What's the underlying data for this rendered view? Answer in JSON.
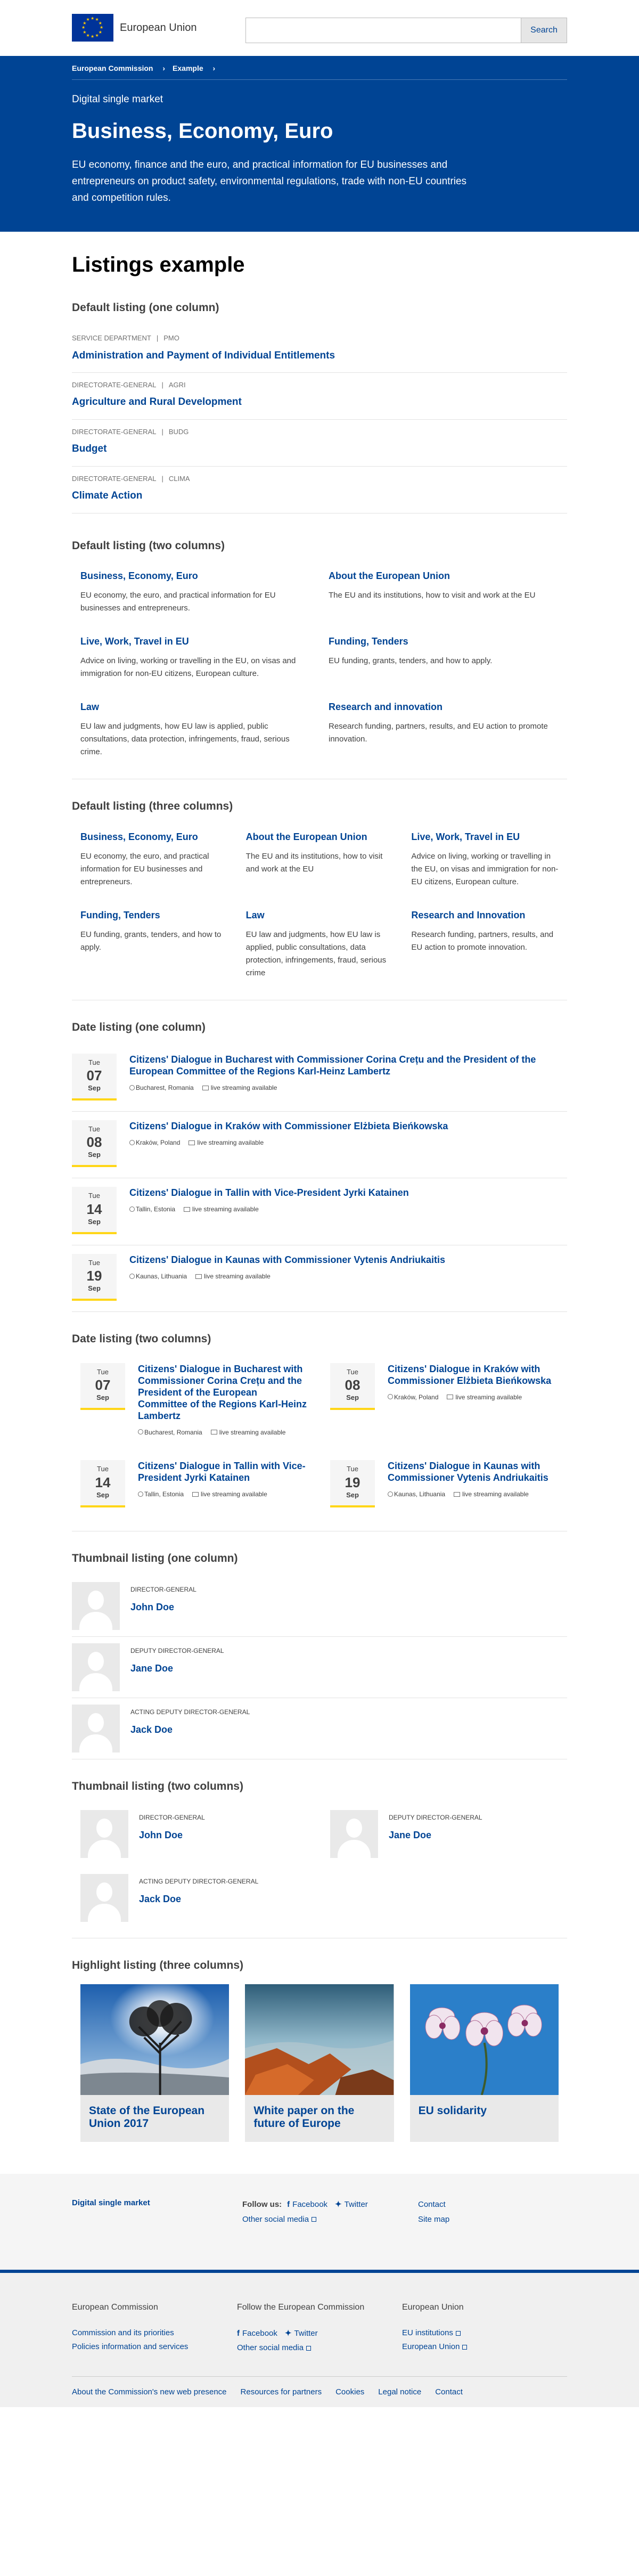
{
  "header": {
    "logo_text": "European Union",
    "search_button": "Search",
    "search_placeholder": ""
  },
  "breadcrumb": [
    "European Commission",
    "Example"
  ],
  "page_header": {
    "meta": "Digital single market",
    "title": "Business, Economy, Euro",
    "intro": "EU economy, finance and the euro, and practical information for EU businesses and entrepreneurs on product safety, environmental regulations, trade with non-EU countries and competition rules."
  },
  "listings_title": "Listings example",
  "default_one": {
    "heading": "Default listing (one column)",
    "items": [
      {
        "type": "SERVICE DEPARTMENT",
        "code": "PMO",
        "title": "Administration and Payment of Individual Entitlements"
      },
      {
        "type": "DIRECTORATE-GENERAL",
        "code": "AGRI",
        "title": "Agriculture and Rural Development"
      },
      {
        "type": "DIRECTORATE-GENERAL",
        "code": "BUDG",
        "title": "Budget"
      },
      {
        "type": "DIRECTORATE-GENERAL",
        "code": "CLIMA",
        "title": "Climate Action"
      }
    ]
  },
  "default_two": {
    "heading": "Default listing (two columns)",
    "items": [
      {
        "title": "Business, Economy, Euro",
        "desc": "EU economy, the euro, and practical information for EU businesses and entrepreneurs."
      },
      {
        "title": "About the European Union",
        "desc": "The EU and its institutions, how to visit and work at the EU"
      },
      {
        "title": "Live, Work, Travel in EU",
        "desc": "Advice on living, working or travelling in the EU, on visas and immigration for non-EU citizens, European culture."
      },
      {
        "title": "Funding, Tenders",
        "desc": "EU funding, grants, tenders, and how to apply."
      },
      {
        "title": "Law",
        "desc": "EU law and judgments, how EU law is applied, public consultations, data protection, infringements, fraud, serious crime."
      },
      {
        "title": "Research and innovation",
        "desc": "Research funding, partners, results, and EU action to promote innovation."
      }
    ]
  },
  "default_three": {
    "heading": "Default listing (three columns)",
    "items": [
      {
        "title": "Business, Economy, Euro",
        "desc": "EU economy, the euro, and practical information for EU businesses and entrepreneurs."
      },
      {
        "title": "About the European Union",
        "desc": "The EU and its institutions, how to visit and work at the EU"
      },
      {
        "title": "Live, Work, Travel in EU",
        "desc": "Advice on living, working or travelling in the EU, on visas and immigration for non-EU citizens, European culture."
      },
      {
        "title": "Funding, Tenders",
        "desc": "EU funding, grants, tenders, and how to apply."
      },
      {
        "title": "Law",
        "desc": "EU law and judgments, how EU law is applied, public consultations, data protection, infringements, fraud, serious crime"
      },
      {
        "title": "Research and Innovation",
        "desc": "Research funding, partners, results, and EU action to promote innovation."
      }
    ]
  },
  "date_one": {
    "heading": "Date listing (one column)",
    "stream_label": "live streaming available",
    "items": [
      {
        "dow": "Tue",
        "day": "07",
        "mon": "Sep",
        "title": "Citizens' Dialogue in Bucharest with Commissioner Corina Crețu and the President of the European Committee of the Regions Karl-Heinz Lambertz",
        "place": "Bucharest, Romania"
      },
      {
        "dow": "Tue",
        "day": "08",
        "mon": "Sep",
        "title": "Citizens' Dialogue in Kraków with Commissioner Elżbieta Bieńkowska",
        "place": "Kraków, Poland"
      },
      {
        "dow": "Tue",
        "day": "14",
        "mon": "Sep",
        "title": "Citizens' Dialogue in Tallin with Vice-President Jyrki Katainen",
        "place": "Tallin, Estonia"
      },
      {
        "dow": "Tue",
        "day": "19",
        "mon": "Sep",
        "title": "Citizens' Dialogue in Kaunas with Commissioner Vytenis Andriukaitis",
        "place": "Kaunas, Lithuania"
      }
    ]
  },
  "date_two": {
    "heading": "Date listing (two columns)",
    "stream_label": "live streaming available",
    "items": [
      {
        "dow": "Tue",
        "day": "07",
        "mon": "Sep",
        "title": "Citizens' Dialogue in Bucharest with Commissioner Corina Crețu and the President of the European Committee of the Regions Karl-Heinz Lambertz",
        "place": "Bucharest, Romania"
      },
      {
        "dow": "Tue",
        "day": "08",
        "mon": "Sep",
        "title": "Citizens' Dialogue in Kraków with Commissioner Elżbieta Bieńkowska",
        "place": "Kraków, Poland"
      },
      {
        "dow": "Tue",
        "day": "14",
        "mon": "Sep",
        "title": "Citizens' Dialogue in Tallin with Vice-President Jyrki Katainen",
        "place": "Tallin, Estonia"
      },
      {
        "dow": "Tue",
        "day": "19",
        "mon": "Sep",
        "title": "Citizens' Dialogue in Kaunas with Commissioner Vytenis Andriukaitis",
        "place": "Kaunas, Lithuania"
      }
    ]
  },
  "thumb_one": {
    "heading": "Thumbnail listing (one column)",
    "items": [
      {
        "role": "DIRECTOR-GENERAL",
        "name": "John Doe"
      },
      {
        "role": "DEPUTY DIRECTOR-GENERAL",
        "name": "Jane Doe"
      },
      {
        "role": "ACTING DEPUTY DIRECTOR-GENERAL",
        "name": "Jack Doe"
      }
    ]
  },
  "thumb_two": {
    "heading": "Thumbnail listing (two columns)",
    "items": [
      {
        "role": "DIRECTOR-GENERAL",
        "name": "John Doe"
      },
      {
        "role": "DEPUTY DIRECTOR-GENERAL",
        "name": "Jane Doe"
      },
      {
        "role": "ACTING DEPUTY DIRECTOR-GENERAL",
        "name": "Jack Doe"
      }
    ]
  },
  "highlight": {
    "heading": "Highlight listing (three columns)",
    "items": [
      {
        "title": "State of the European Union 2017",
        "image": "sunburst-tree-image"
      },
      {
        "title": "White paper on the future of Europe",
        "image": "coastal-rocks-image"
      },
      {
        "title": "EU solidarity",
        "image": "orchid-flowers-image"
      }
    ]
  },
  "footer_top": {
    "site_name": "Digital single market",
    "follow_label": "Follow us:",
    "facebook": "Facebook",
    "twitter": "Twitter",
    "other_social": "Other social media",
    "contact": "Contact",
    "sitemap": "Site map"
  },
  "footer_bottom": {
    "col1_heading": "European Commission",
    "col1_links": [
      "Commission and its priorities",
      "Policies information and services"
    ],
    "col2_heading": "Follow the European Commission",
    "facebook": "Facebook",
    "twitter": "Twitter",
    "other_social": "Other social media",
    "col3_heading": "European Union",
    "col3_links": [
      "EU institutions",
      "European Union"
    ],
    "bottom_links": [
      "About the Commission's new web presence",
      "Resources for partners",
      "Cookies",
      "Legal notice",
      "Contact"
    ]
  },
  "colors": {
    "primary_blue": "#004494",
    "accent_yellow": "#ffd617",
    "flag_blue": "#003399",
    "flag_star": "#ffcc00"
  }
}
